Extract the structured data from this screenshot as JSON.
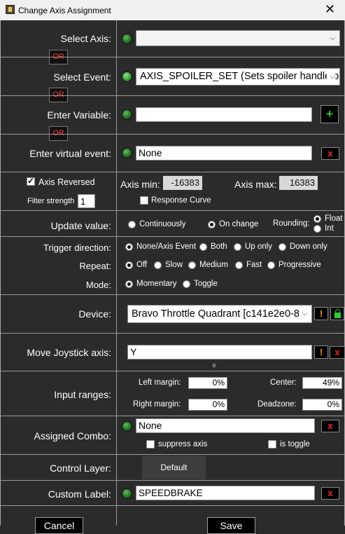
{
  "window": {
    "title": "Change Axis Assignment"
  },
  "or_label": "OR",
  "select_axis": {
    "label": "Select Axis:",
    "value": ""
  },
  "select_event": {
    "label": "Select Event:",
    "value": "AXIS_SPOILER_SET (Sets spoiler handle pc"
  },
  "enter_variable": {
    "label": "Enter Variable:",
    "value": "",
    "add_symbol": "+"
  },
  "virtual_event": {
    "label": "Enter virtual event:",
    "value": "None",
    "clear_symbol": "x"
  },
  "axis": {
    "reversed_label": "Axis Reversed",
    "reversed_checked": true,
    "filter_strength_label": "Filter strength",
    "filter_strength": "1",
    "min_label": "Axis min:",
    "min_value": "-16383",
    "max_label": "Axis max:",
    "max_value": "16383",
    "response_curve_label": "Response Curve",
    "response_curve_checked": false
  },
  "update_value": {
    "label": "Update value:",
    "options": [
      "Continuously",
      "On change"
    ],
    "selected": "On change",
    "rounding_label": "Rounding:",
    "rounding_options": [
      "Float",
      "Int"
    ],
    "rounding_selected": "Float"
  },
  "trigger_direction": {
    "label": "Trigger direction:",
    "options": [
      "None/Axis Event",
      "Both",
      "Up only",
      "Down only"
    ],
    "selected": "None/Axis Event"
  },
  "repeat": {
    "label": "Repeat:",
    "options": [
      "Off",
      "Slow",
      "Medium",
      "Fast",
      "Progressive"
    ],
    "selected": "Off"
  },
  "mode": {
    "label": "Mode:",
    "options": [
      "Momentary",
      "Toggle"
    ],
    "selected": "Momentary"
  },
  "device": {
    "label": "Device:",
    "value": "Bravo Throttle Quadrant [c141e2e0-8",
    "warn_symbol": "!"
  },
  "move_joystick": {
    "label": "Move Joystick axis:",
    "value": "Y",
    "readout": "0",
    "warn_symbol": "!",
    "clear_symbol": "x"
  },
  "input_ranges": {
    "label": "Input ranges:",
    "left_margin_label": "Left margin:",
    "left_margin": "0%",
    "center_label": "Center:",
    "center": "49%",
    "right_margin_label": "Right margin:",
    "right_margin": "0%",
    "deadzone_label": "Deadzone:",
    "deadzone": "0%"
  },
  "assigned_combo": {
    "label": "Assigned Combo:",
    "value": "None",
    "clear_symbol": "x",
    "suppress_axis_label": "suppress axis",
    "is_toggle_label": "is toggle"
  },
  "control_layer": {
    "label": "Control Layer:",
    "value": "Default"
  },
  "custom_label": {
    "label": "Custom Label:",
    "value": "SPEEDBRAKE",
    "clear_symbol": "x"
  },
  "buttons": {
    "cancel": "Cancel",
    "save": "Save"
  },
  "colors": {
    "led_green": "#2f8f2f",
    "or_red": "#ff3a2a",
    "x_red": "#ff2222",
    "plus_green": "#2ecc2e",
    "warn_orange": "#ff9a00"
  }
}
